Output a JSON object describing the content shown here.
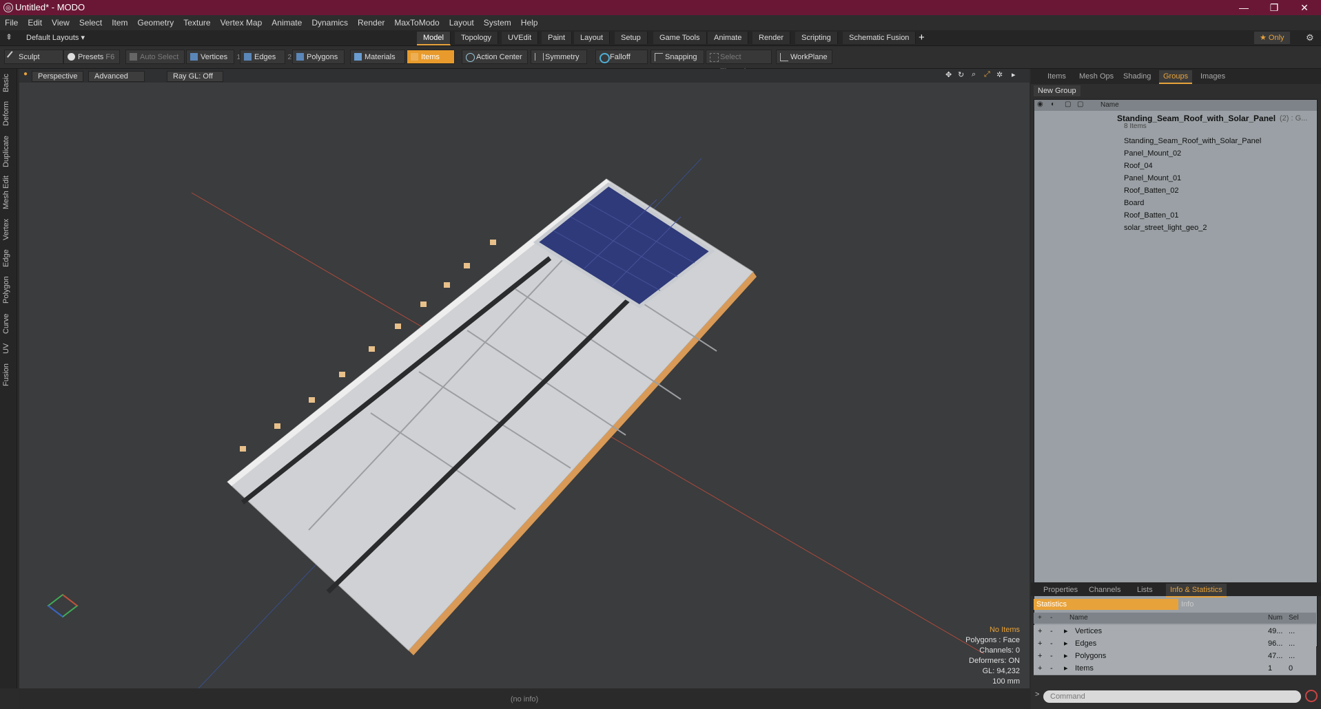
{
  "window": {
    "title": "Untitled* - MODO",
    "minimize": "—",
    "maximize": "❐",
    "close": "✕"
  },
  "menu": [
    "File",
    "Edit",
    "View",
    "Select",
    "Item",
    "Geometry",
    "Texture",
    "Vertex Map",
    "Animate",
    "Dynamics",
    "Render",
    "MaxToModo",
    "Layout",
    "System",
    "Help"
  ],
  "layout": {
    "default_layouts": "Default Layouts ▾",
    "tabs": [
      "Model",
      "Topology",
      "UVEdit",
      "Paint",
      "Layout",
      "Setup",
      "Game Tools",
      "Animate",
      "Render",
      "Scripting",
      "Schematic Fusion"
    ],
    "add": "+",
    "only": "★ Only"
  },
  "toolbar": {
    "sculpt": "Sculpt",
    "presets": "Presets",
    "presets_key": "F6",
    "auto_select": "Auto Select",
    "vertices": "Vertices",
    "vertices_num": "1",
    "edges": "Edges",
    "edges_num": "2",
    "polygons": "Polygons",
    "materials": "Materials",
    "items": "Items",
    "items_num": "5",
    "action_center": "Action Center",
    "symmetry": "Symmetry",
    "falloff": "Falloff",
    "snapping": "Snapping",
    "select_through": "Select Through",
    "workplane": "WorkPlane"
  },
  "left_tabs": [
    "Basic",
    "Deform",
    "Duplicate",
    "Mesh Edit",
    "Vertex",
    "Edge",
    "Polygon",
    "Curve",
    "UV",
    "Fusion"
  ],
  "viewport": {
    "perspective": "Perspective",
    "advanced": "Advanced",
    "raygl": "Ray GL: Off",
    "hud": {
      "no_items": "No Items",
      "polygons": "Polygons : Face",
      "channels": "Channels: 0",
      "deformers": "Deformers: ON",
      "gl": "GL: 94,232",
      "scale": "100 mm"
    }
  },
  "status": "(no info)",
  "right_panel": {
    "tabs": [
      "Items",
      "Mesh Ops",
      "Shading",
      "Groups",
      "Images"
    ],
    "new_group": "New Group",
    "name_header": "Name",
    "group_name": "Standing_Seam_Roof_with_Solar_Panel",
    "group_suffix": "(2) : G...",
    "group_count": "8 Items",
    "items": [
      "Standing_Seam_Roof_with_Solar_Panel",
      "Panel_Mount_02",
      "Roof_04",
      "Panel_Mount_01",
      "Roof_Batten_02",
      "Board",
      "Roof_Batten_01",
      "solar_street_light_geo_2"
    ],
    "bottom_tabs": [
      "Properties",
      "Channels",
      "Lists",
      "Info & Statistics"
    ],
    "statistics": "Statistics",
    "info": "Info",
    "stats_headers": {
      "name": "Name",
      "num": "Num",
      "sel": "Sel"
    },
    "stats": [
      {
        "name": "Vertices",
        "num": "49...",
        "sel": "..."
      },
      {
        "name": "Edges",
        "num": "96...",
        "sel": "..."
      },
      {
        "name": "Polygons",
        "num": "47...",
        "sel": "..."
      },
      {
        "name": "Items",
        "num": "1",
        "sel": "0"
      }
    ],
    "command": "Command"
  },
  "colors": {
    "accent": "#e89b2c",
    "titlebar": "#6a1735"
  }
}
